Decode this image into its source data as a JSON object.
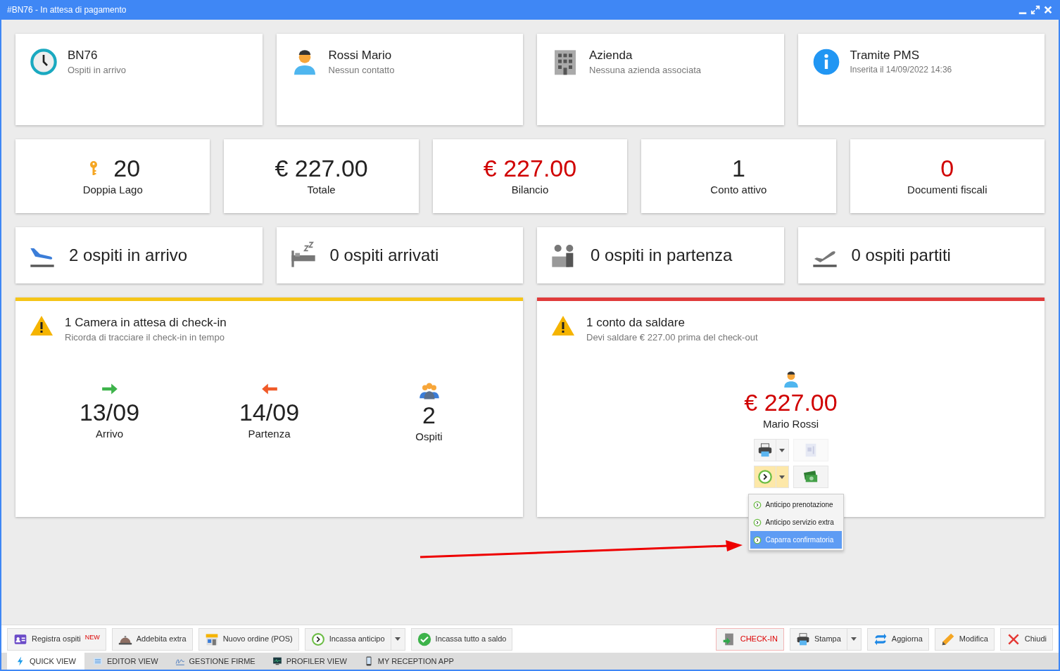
{
  "window": {
    "title": "#BN76 - In attesa di pagamento"
  },
  "info_cards": [
    {
      "kind": "clock",
      "title": "BN76",
      "subtitle": "Ospiti in arrivo"
    },
    {
      "kind": "person",
      "title": "Rossi Mario",
      "subtitle": "Nessun contatto"
    },
    {
      "kind": "building",
      "title": "Azienda",
      "subtitle": "Nessuna azienda associata"
    },
    {
      "kind": "info",
      "title": "Tramite PMS",
      "subtitle": "Inserita il 14/09/2022 14:36"
    }
  ],
  "stat_cards": [
    {
      "kind": "key",
      "value": "20",
      "label": "Doppia Lago",
      "alert": false
    },
    {
      "kind": "plain",
      "value": "€ 227.00",
      "label": "Totale",
      "alert": false
    },
    {
      "kind": "plain",
      "value": "€ 227.00",
      "label": "Bilancio",
      "alert": true
    },
    {
      "kind": "plain",
      "value": "1",
      "label": "Conto attivo",
      "alert": false
    },
    {
      "kind": "plain",
      "value": "0",
      "label": "Documenti fiscali",
      "alert": true
    }
  ],
  "guest_cards": [
    {
      "kind": "plane-landing",
      "text": "2 ospiti in arrivo"
    },
    {
      "kind": "bed",
      "text": "0 ospiti arrivati"
    },
    {
      "kind": "desk",
      "text": "0 ospiti in partenza"
    },
    {
      "kind": "plane-takeoff",
      "text": "0 ospiti partiti"
    }
  ],
  "panels": [
    {
      "kind": "stays",
      "color": "#f5c518",
      "title": "1 Camera in attesa di check-in",
      "subtitle": "Ricorda di tracciare il check-in in tempo",
      "stats": [
        {
          "kind": "arrow-right",
          "value": "13/09",
          "label": "Arrivo"
        },
        {
          "kind": "arrow-left",
          "value": "14/09",
          "label": "Partenza"
        },
        {
          "kind": "people",
          "value": "2",
          "label": "Ospiti"
        }
      ]
    },
    {
      "kind": "payment",
      "color": "#e03c3c",
      "title": "1 conto da saldare",
      "subtitle": "Devi saldare € 227.00 prima del check-out",
      "amount": "€ 227.00",
      "name": "Mario Rossi",
      "actions": [
        {
          "kind": "printer",
          "split": true,
          "expanded": false,
          "disabled": false
        },
        {
          "kind": "document",
          "split": false,
          "expanded": false,
          "disabled": true
        },
        {
          "kind": "deposit",
          "split": true,
          "expanded": true,
          "disabled": false
        },
        {
          "kind": "money",
          "split": false,
          "expanded": false,
          "disabled": false
        }
      ],
      "menu": [
        {
          "label": "Anticipo prenotazione",
          "selected": false
        },
        {
          "label": "Anticipo servizio extra",
          "selected": false
        },
        {
          "label": "Caparra confirmatoria",
          "selected": true
        }
      ]
    }
  ],
  "toolbar_left": [
    {
      "kind": "badge-card",
      "label": "Registra ospiti",
      "badge": "NEW",
      "split": false
    },
    {
      "kind": "bell",
      "label": "Addebita extra",
      "split": false
    },
    {
      "kind": "shop",
      "label": "Nuovo ordine (POS)",
      "split": false
    },
    {
      "kind": "deposit",
      "label": "Incassa anticipo",
      "split": true
    },
    {
      "kind": "check",
      "label": "Incassa tutto a saldo",
      "split": false
    }
  ],
  "toolbar_right": [
    {
      "kind": "door",
      "label": "CHECK-IN",
      "danger": true,
      "split": false
    },
    {
      "kind": "printer",
      "label": "Stampa",
      "danger": false,
      "split": true
    },
    {
      "kind": "refresh",
      "label": "Aggiorna",
      "danger": false,
      "split": false
    },
    {
      "kind": "pencil",
      "label": "Modifica",
      "danger": false,
      "split": false
    },
    {
      "kind": "close-x",
      "label": "Chiudi",
      "danger": false,
      "split": false
    }
  ],
  "tabs": [
    {
      "kind": "bolt",
      "label": "QUICK VIEW",
      "selected": true
    },
    {
      "kind": "list",
      "label": "EDITOR VIEW",
      "selected": false
    },
    {
      "kind": "signature",
      "label": "GESTIONE FIRME",
      "selected": false
    },
    {
      "kind": "monitor",
      "label": "PROFILER VIEW",
      "selected": false
    },
    {
      "kind": "phone",
      "label": "MY RECEPTION APP",
      "selected": false
    }
  ]
}
